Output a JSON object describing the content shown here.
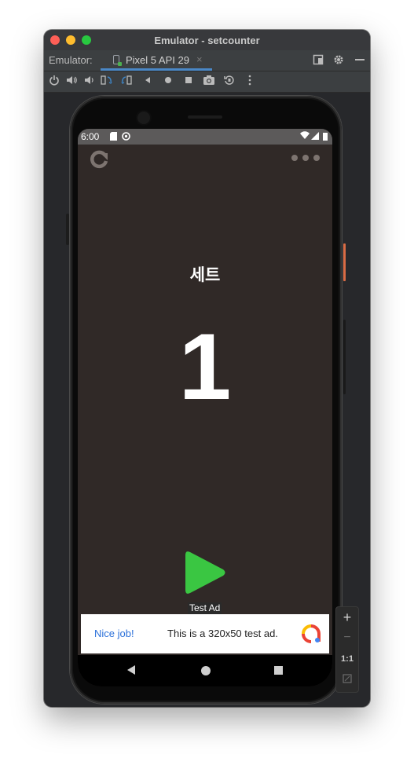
{
  "window": {
    "title": "Emulator - setcounter",
    "emulator_label": "Emulator:",
    "tab_label": "Pixel 5 API 29",
    "tab_close": "×"
  },
  "toolbar_icons": [
    "power-icon",
    "volume-up-icon",
    "volume-down-icon",
    "rotate-left-icon",
    "rotate-right-icon",
    "back-icon",
    "home-icon",
    "overview-icon",
    "screenshot-icon",
    "snapshot-icon",
    "more-icon"
  ],
  "status_bar": {
    "time": "6:00",
    "right_icons": "▾◢▮"
  },
  "app": {
    "set_label": "세트",
    "count": "1"
  },
  "ad": {
    "tag": "Test Ad",
    "cta": "Nice job!",
    "text": "This is a 320x50 test ad."
  },
  "zoom": {
    "plus": "+",
    "minus": "−",
    "one_to_one": "1:1"
  },
  "colors": {
    "app_background": "#302927",
    "play_green": "#3ac642",
    "status_bar": "#5c5a5a"
  }
}
